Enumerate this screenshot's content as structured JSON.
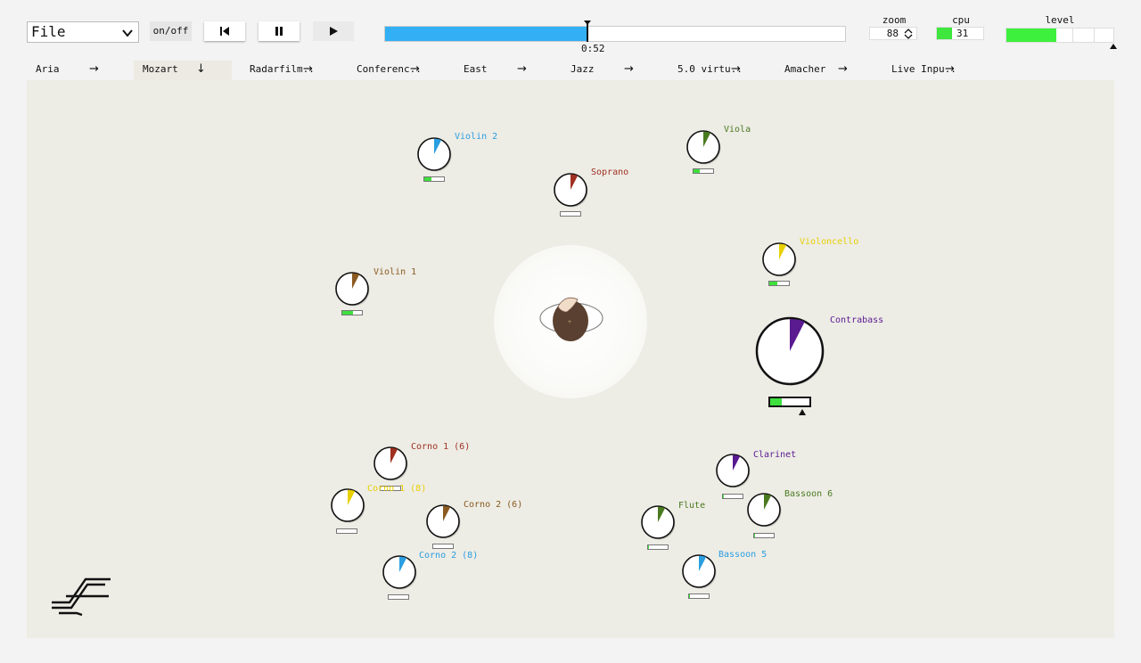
{
  "toolbar": {
    "file_label": "File",
    "onoff_label": "on/off",
    "time": "0:52",
    "progress": 0.44,
    "zoom_label": "zoom",
    "zoom_value": "88",
    "cpu_label": "cpu",
    "cpu_value": "31",
    "cpu_level": 0.33,
    "level_label": "level",
    "level_value": 0.47
  },
  "tabs": [
    {
      "label": "Aria",
      "arrow": "→"
    },
    {
      "label": "Mozart",
      "arrow": "↓"
    },
    {
      "label": "Radarfilm..",
      "arrow": "→"
    },
    {
      "label": "Conferenc..",
      "arrow": "→"
    },
    {
      "label": "East",
      "arrow": "→"
    },
    {
      "label": "Jazz",
      "arrow": "→"
    },
    {
      "label": "5.0 virtu..",
      "arrow": "→"
    },
    {
      "label": "Amacher",
      "arrow": "→"
    },
    {
      "label": "Live Inpu..",
      "arrow": "→"
    }
  ],
  "colors": {
    "accent_blue": "#33b0f5",
    "meter_green": "#3ee03e",
    "stage_bg": "#edece5"
  },
  "sources": [
    {
      "name": "Violin 2",
      "color": "#2a9ee0",
      "level": 0.35
    },
    {
      "name": "Soprano",
      "color": "#a03020",
      "level": 0.0
    },
    {
      "name": "Viola",
      "color": "#4a7a20",
      "level": 0.3
    },
    {
      "name": "Violoncello",
      "color": "#e8d000",
      "level": 0.4
    },
    {
      "name": "Violin 1",
      "color": "#8a5a20",
      "level": 0.55
    },
    {
      "name": "Contrabass",
      "color": "#5a1a90",
      "level": 0.3
    },
    {
      "name": "Corno 1 (6)",
      "color": "#a03020",
      "level": 0.0
    },
    {
      "name": "Corno 1 (8)",
      "color": "#e8d000",
      "level": 0.0
    },
    {
      "name": "Corno 2 (6)",
      "color": "#8a5a20",
      "level": 0.0
    },
    {
      "name": "Corno 2 (8)",
      "color": "#2a9ee0",
      "level": 0.0
    },
    {
      "name": "Clarinet",
      "color": "#5a1a90",
      "level": 0.05
    },
    {
      "name": "Bassoon 6",
      "color": "#4a7a20",
      "level": 0.05
    },
    {
      "name": "Flute",
      "color": "#4a7a20",
      "level": 0.05
    },
    {
      "name": "Bassoon 5",
      "color": "#2a9ee0",
      "level": 0.05
    }
  ]
}
